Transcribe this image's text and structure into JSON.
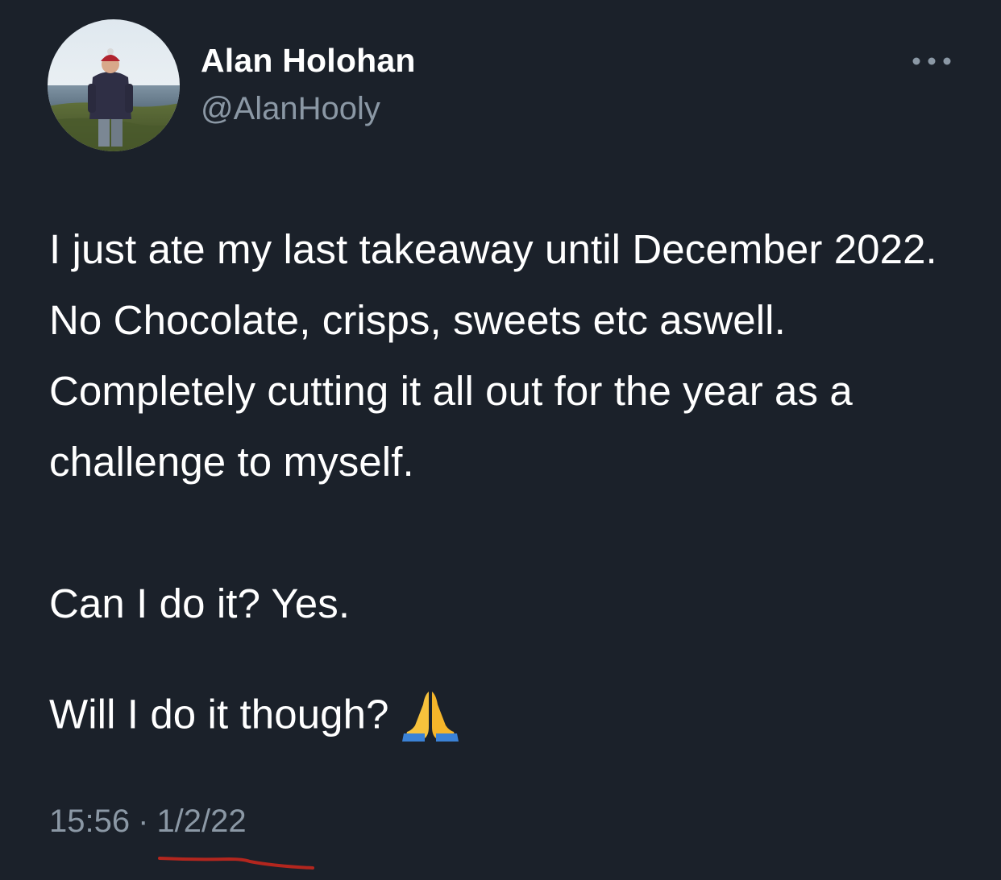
{
  "author": {
    "display_name": "Alan Holohan",
    "handle": "@AlanHooly"
  },
  "menu": {
    "icon": "more-dots-icon"
  },
  "tweet": {
    "paragraphs": [
      "I just ate my last takeaway until December 2022. No Chocolate, crisps, sweets etc aswell. Completely cutting it all out for the year as a challenge to myself.",
      "Can I do it? Yes.",
      "Will I do it though?"
    ],
    "emoji": "folded-hands-emoji"
  },
  "meta": {
    "time": "15:56",
    "separator": "·",
    "date": "1/2/22"
  },
  "colors": {
    "background": "#1b212a",
    "text_primary": "#ffffff",
    "text_secondary": "#8b98a5",
    "annotation_underline": "#b3261e"
  }
}
